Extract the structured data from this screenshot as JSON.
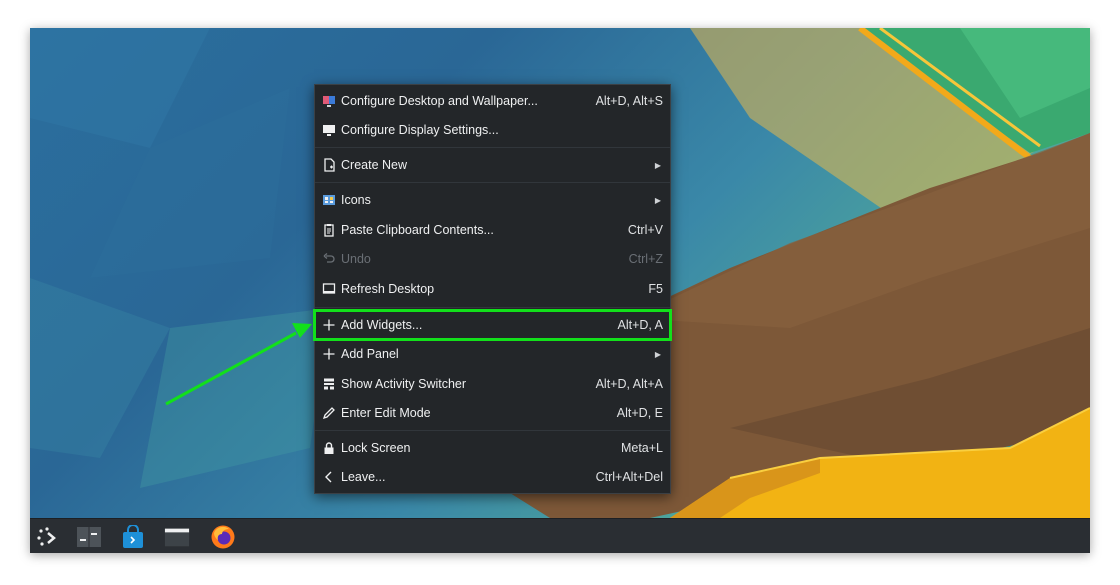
{
  "desktop_menu": {
    "items": [
      {
        "label": "Configure Desktop and Wallpaper...",
        "shortcut": "Alt+D, Alt+S",
        "icon": "configure-desktop-icon"
      },
      {
        "label": "Configure Display Settings...",
        "shortcut": "",
        "icon": "display-icon"
      },
      {
        "label": "Create New",
        "shortcut": "",
        "icon": "new-file-icon",
        "submenu": true
      },
      {
        "label": "Icons",
        "shortcut": "",
        "icon": "icons-view-icon",
        "submenu": true
      },
      {
        "label": "Paste Clipboard Contents...",
        "shortcut": "Ctrl+V",
        "icon": "clipboard-icon"
      },
      {
        "label": "Undo",
        "shortcut": "Ctrl+Z",
        "icon": "undo-icon",
        "disabled": true
      },
      {
        "label": "Refresh Desktop",
        "shortcut": "F5",
        "icon": "refresh-desktop-icon"
      },
      {
        "label": "Add Widgets...",
        "shortcut": "Alt+D, A",
        "icon": "plus-icon",
        "highlighted": true
      },
      {
        "label": "Add Panel",
        "shortcut": "",
        "icon": "plus-icon",
        "submenu": true
      },
      {
        "label": "Show Activity Switcher",
        "shortcut": "Alt+D, Alt+A",
        "icon": "activities-icon"
      },
      {
        "label": "Enter Edit Mode",
        "shortcut": "Alt+D, E",
        "icon": "edit-icon"
      },
      {
        "label": "Lock Screen",
        "shortcut": "Meta+L",
        "icon": "lock-icon"
      },
      {
        "label": "Leave...",
        "shortcut": "Ctrl+Alt+Del",
        "icon": "chevron-left-icon"
      }
    ]
  },
  "taskbar": {
    "items": [
      "app-launcher-icon",
      "pager-icon",
      "discover-store-icon",
      "file-manager-icon",
      "firefox-icon"
    ]
  },
  "colors": {
    "annotation": "#12e01b",
    "menu_bg": "#232629",
    "taskbar_bg": "#2a2e33"
  }
}
